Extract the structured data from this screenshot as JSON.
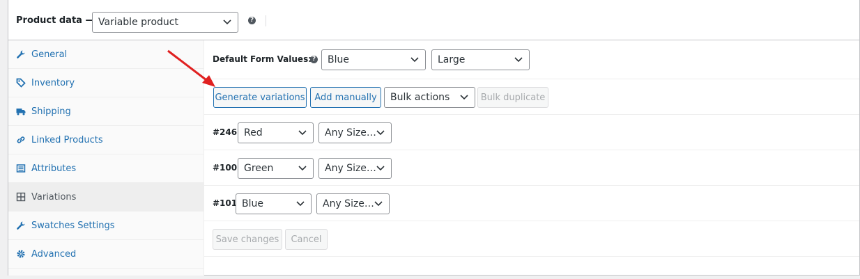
{
  "header": {
    "title": "Product data —",
    "product_type": "Variable product"
  },
  "sidebar": {
    "items": [
      {
        "label": "General",
        "icon": "wrench-icon"
      },
      {
        "label": "Inventory",
        "icon": "tag-icon"
      },
      {
        "label": "Shipping",
        "icon": "truck-icon"
      },
      {
        "label": "Linked Products",
        "icon": "link-icon"
      },
      {
        "label": "Attributes",
        "icon": "list-icon"
      },
      {
        "label": "Variations",
        "icon": "grid-icon",
        "active": true
      },
      {
        "label": "Swatches Settings",
        "icon": "wrench-icon"
      },
      {
        "label": "Advanced",
        "icon": "gear-icon"
      }
    ]
  },
  "defaults": {
    "label": "Default Form Values:",
    "color": "Blue",
    "size": "Large"
  },
  "toolbar": {
    "generate": "Generate variations",
    "add_manually": "Add manually",
    "bulk_actions": "Bulk actions",
    "bulk_duplicate": "Bulk duplicate"
  },
  "variations": [
    {
      "id": "#246",
      "color": "Red",
      "size": "Any Size…"
    },
    {
      "id": "#100",
      "color": "Green",
      "size": "Any Size…"
    },
    {
      "id": "#101",
      "color": "Blue",
      "size": "Any Size…"
    }
  ],
  "footer": {
    "save": "Save changes",
    "cancel": "Cancel"
  },
  "colors": {
    "link": "#2271b1",
    "arrow": "#e02020",
    "disabled_text": "#a7aaad"
  }
}
